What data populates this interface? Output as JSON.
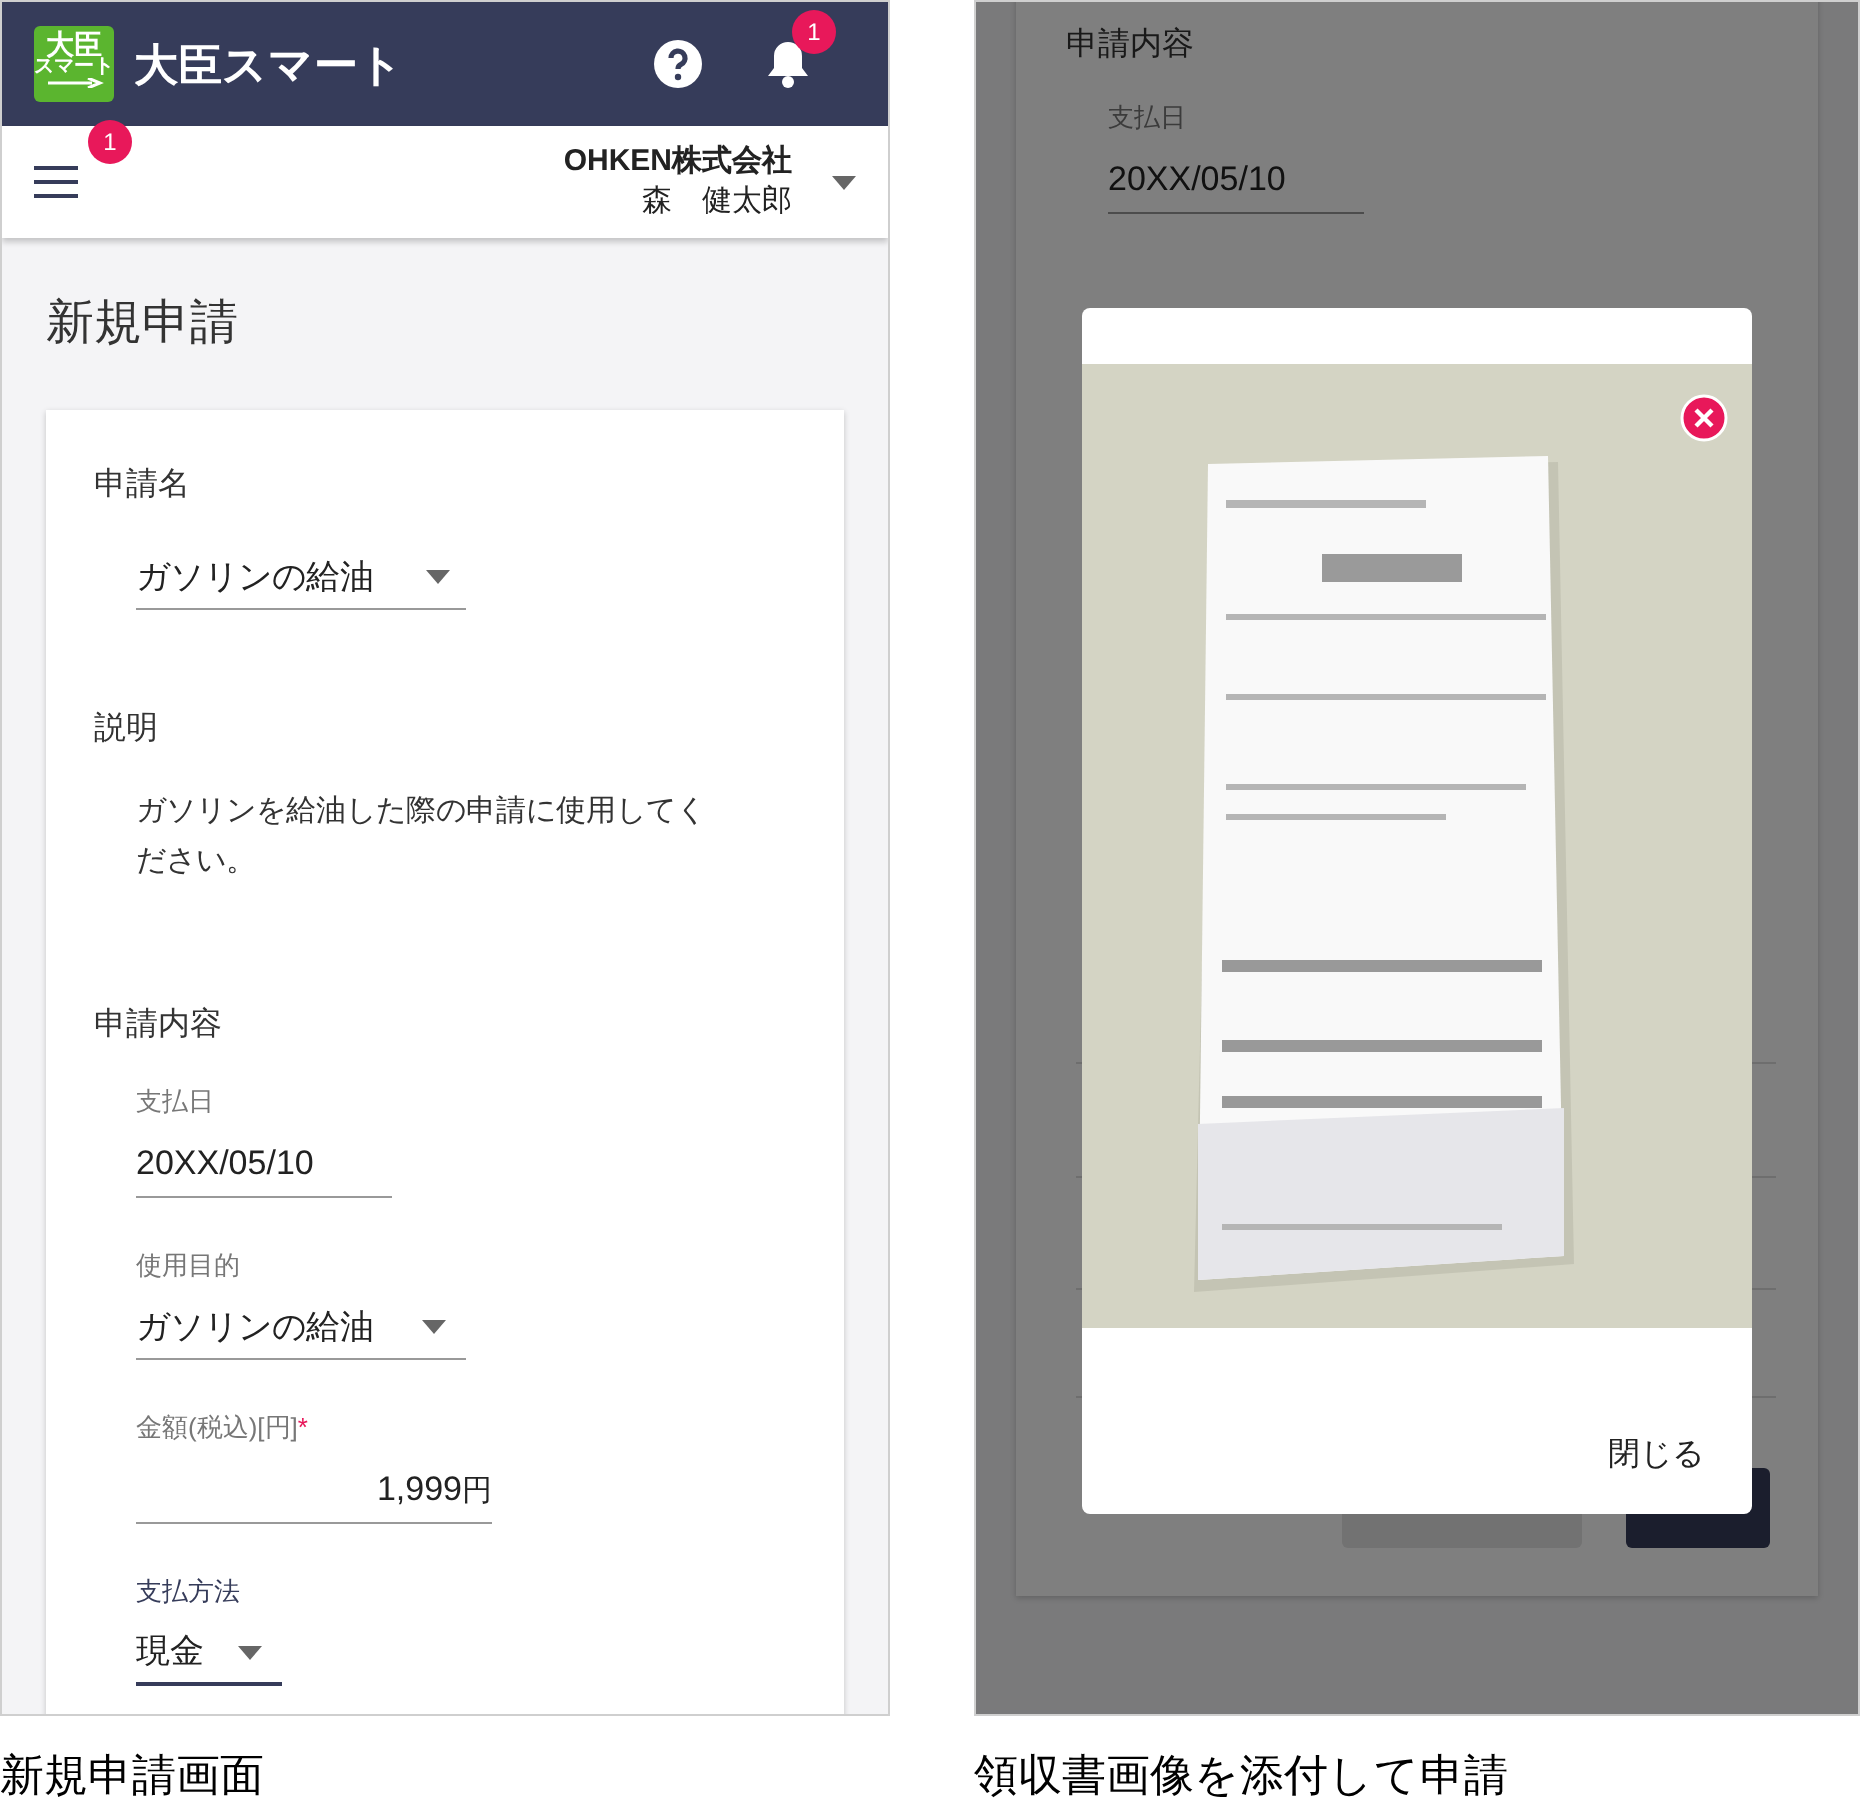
{
  "left_screen": {
    "app_bar": {
      "logo_text": [
        "大臣",
        "スマート"
      ],
      "title": "大臣スマート",
      "notification_count": "1"
    },
    "user_bar": {
      "menu_badge": "1",
      "company": "OHKEN株式会社",
      "user": "森　健太郎"
    },
    "page_title": "新規申請",
    "form": {
      "name_label": "申請名",
      "name_value": "ガソリンの給油",
      "description_label": "説明",
      "description": "ガソリンを給油した際の申請に使用してください。",
      "section_title": "申請内容",
      "required_mark": "*",
      "fields": [
        {
          "kind": "text",
          "label": "支払日",
          "value": "20XX/05/10",
          "required": false,
          "focused": false
        },
        {
          "kind": "select",
          "label": "使用目的",
          "value": "ガソリンの給油",
          "required": false,
          "focused": false
        },
        {
          "kind": "amount",
          "label": "金額(税込)[円]",
          "value": "1,999",
          "unit": "円",
          "required": true,
          "focused": false
        },
        {
          "kind": "select",
          "label": "支払方法",
          "value": "現金",
          "required": false,
          "focused": true
        }
      ]
    }
  },
  "right_screen": {
    "background_form": {
      "section_title": "申請内容",
      "date_label": "支払日",
      "date_value": "20XX/05/10"
    },
    "dialog": {
      "close_label": "閉じる"
    }
  },
  "captions": [
    "新規申請画面",
    "領収書画像を添付して申請"
  ]
}
